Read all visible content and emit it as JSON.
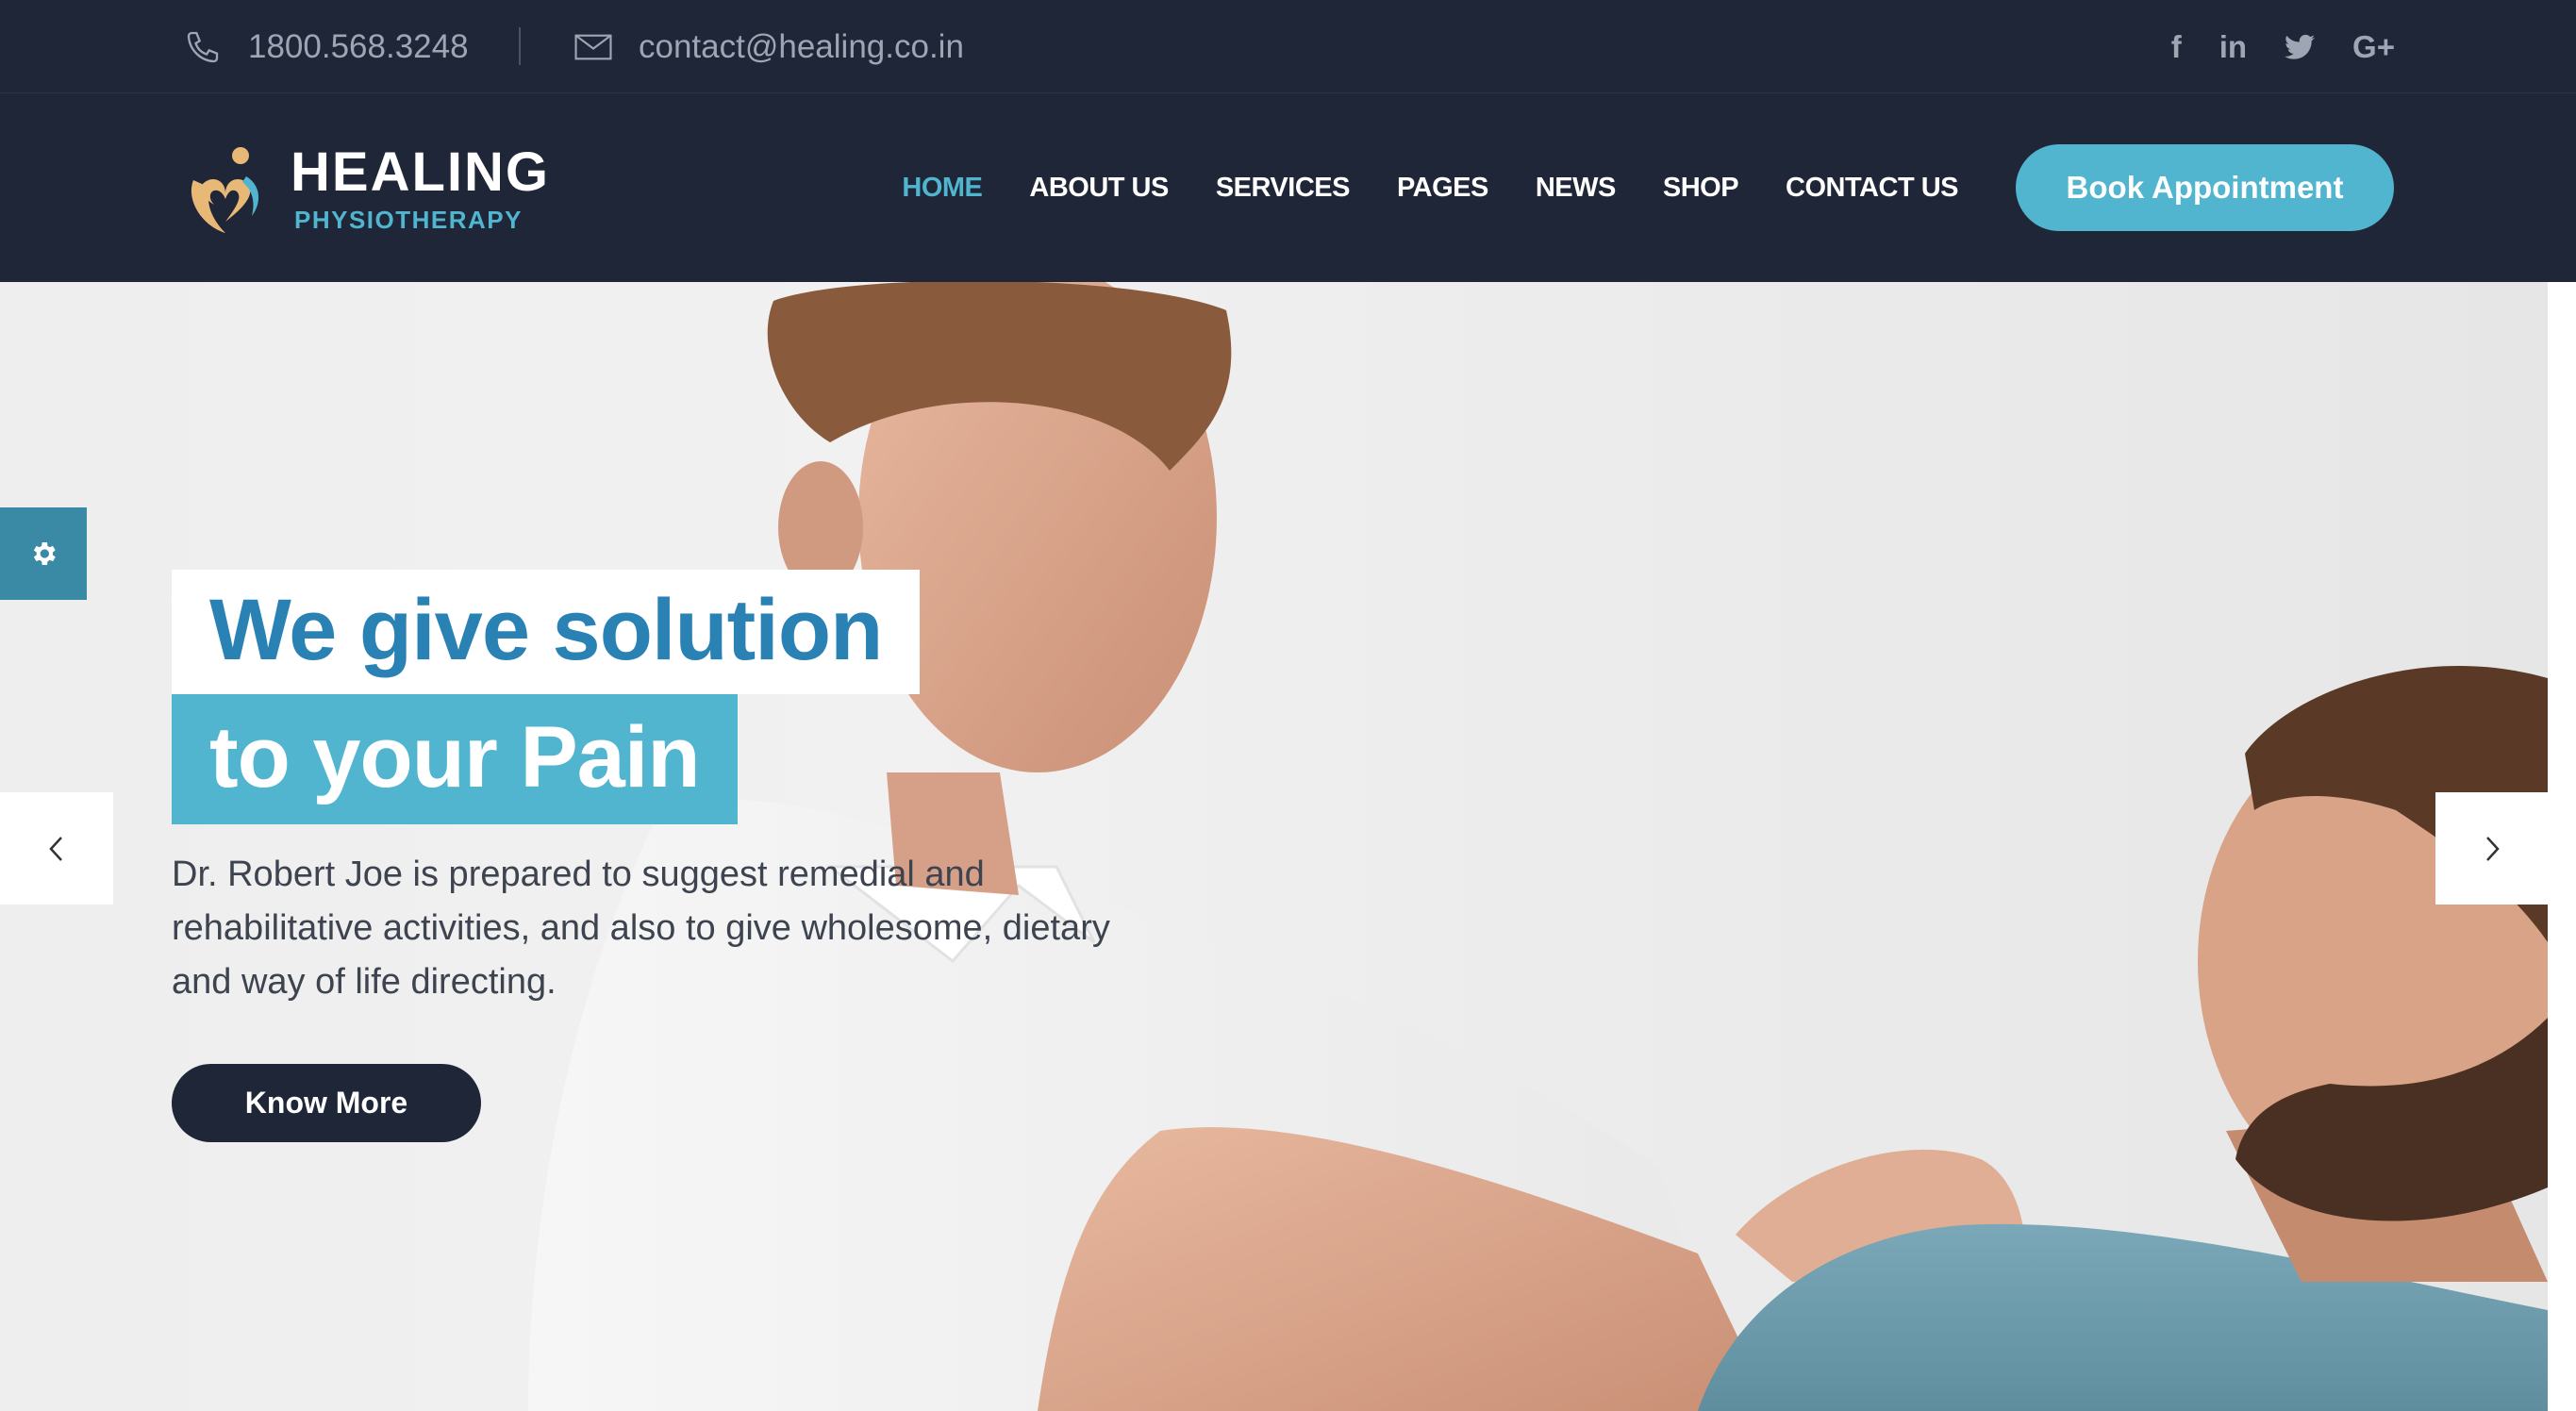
{
  "topbar": {
    "phone": "1800.568.3248",
    "email": "contact@healing.co.in",
    "social": [
      {
        "icon": "facebook-icon",
        "glyph": "f"
      },
      {
        "icon": "linkedin-icon",
        "glyph": "in"
      },
      {
        "icon": "twitter-icon",
        "glyph": "t"
      },
      {
        "icon": "google-plus-icon",
        "glyph": "G+"
      }
    ]
  },
  "header": {
    "logo_title": "HEALING",
    "logo_subtitle": "PHYSIOTHERAPY",
    "nav": [
      "HOME",
      "ABOUT US",
      "SERVICES",
      "PAGES",
      "NEWS",
      "SHOP",
      "CONTACT US"
    ],
    "active_nav": "HOME",
    "cta": "Book Appointment"
  },
  "hero": {
    "headline_1": "We give solution",
    "headline_2": "to your Pain",
    "description": "Dr. Robert Joe is prepared to suggest remedial and rehabilitative activities, and also to give wholesome, dietary and way of life directing.",
    "button": "Know More"
  },
  "colors": {
    "dark": "#1e2637",
    "accent": "#52b5cf",
    "headline_blue": "#2a82b4",
    "muted_text": "#9ea5b3"
  }
}
